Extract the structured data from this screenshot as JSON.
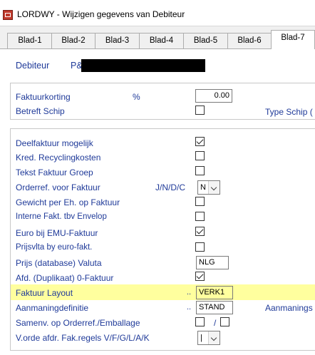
{
  "window": {
    "title": "LORDWY - Wijzigen gegevens van Debiteur"
  },
  "tabs": [
    {
      "label": "Blad-1"
    },
    {
      "label": "Blad-2"
    },
    {
      "label": "Blad-3"
    },
    {
      "label": "Blad-4"
    },
    {
      "label": "Blad-5"
    },
    {
      "label": "Blad-6"
    },
    {
      "label": "Blad-7",
      "active": true
    }
  ],
  "debiteur": {
    "label": "Debiteur",
    "value_prefix": "P&"
  },
  "group1": {
    "faktuurkorting": {
      "label": "Faktuurkorting",
      "unit": "%",
      "value": "0.00"
    },
    "betreft_schip": {
      "label": "Betreft Schip",
      "checked": false,
      "right_label": "Type Schip ("
    }
  },
  "group2": {
    "deelfaktuur": {
      "label": "Deelfaktuur mogelijk",
      "checked": true
    },
    "kred_recycling": {
      "label": "Kred. Recyclingkosten",
      "checked": false
    },
    "tekst_faktuur_groep": {
      "label": "Tekst Faktuur Groep",
      "checked": false
    },
    "orderref": {
      "label": "Orderref. voor Faktuur",
      "options_hint": "J/N/D/C",
      "value": "N"
    },
    "gewicht": {
      "label": "Gewicht per Eh. op Faktuur",
      "checked": false
    },
    "interne_fakt": {
      "label": "Interne Fakt. tbv Envelop",
      "checked": false
    },
    "euro_emu": {
      "label": "Euro bij EMU-Faktuur",
      "checked": true
    },
    "prijsvlta": {
      "label": "Prijsvlta by euro-fakt.",
      "checked": false
    },
    "prijs_valuta": {
      "label": "Prijs (database) Valuta",
      "value": "NLG"
    },
    "afd_duplikaat": {
      "label": "Afd. (Duplikaat) 0-Faktuur",
      "checked": true
    },
    "faktuur_layout": {
      "label": "Faktuur Layout",
      "dots": "..",
      "value": "VERK1"
    },
    "aanmaningdefinitie": {
      "label": "Aanmaningdefinitie",
      "dots": "..",
      "value": "STAND",
      "right_label": "Aanmanings"
    },
    "samenv": {
      "label": "Samenv. op Orderref./Emballage",
      "checked_a": false,
      "sep": "/",
      "checked_b": false
    },
    "vorde": {
      "label": "V.orde afdr. Fak.regels V/F/G/L/A/K",
      "value": "|"
    }
  }
}
